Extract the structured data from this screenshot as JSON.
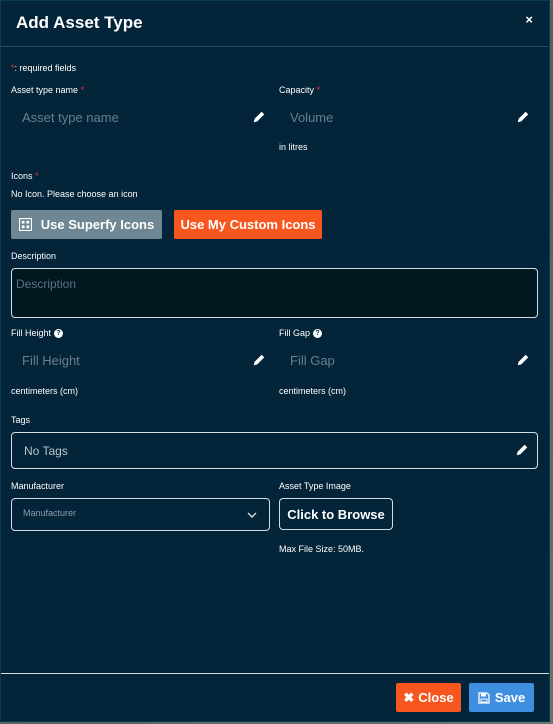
{
  "dialog": {
    "title": "Add Asset Type",
    "close_symbol": "×"
  },
  "required_note": {
    "star": "*",
    "text": ": required fields"
  },
  "asset_type_name": {
    "label": "Asset type name",
    "star": "*",
    "placeholder": "Asset type name"
  },
  "capacity": {
    "label": "Capacity",
    "star": "*",
    "placeholder": "Volume",
    "unit": "in litres"
  },
  "icons": {
    "label": "Icons",
    "star": "*",
    "status": "No Icon. Please choose an icon",
    "superfy_button": "Use Superfy Icons",
    "custom_button": "Use My Custom Icons"
  },
  "description": {
    "label": "Description",
    "placeholder": "Description"
  },
  "fill_height": {
    "label": "Fill Height",
    "help": "?",
    "placeholder": "Fill Height",
    "unit": "centimeters (cm)"
  },
  "fill_gap": {
    "label": "Fill Gap",
    "help": "?",
    "placeholder": "Fill Gap",
    "unit": "centimeters (cm)"
  },
  "tags": {
    "label": "Tags",
    "placeholder": "No Tags"
  },
  "manufacturer": {
    "label": "Manufacturer",
    "placeholder": "Manufacturer"
  },
  "asset_type_image": {
    "label": "Asset Type Image",
    "browse_button": "Click to Browse",
    "max_size": "Max File Size: 50MB."
  },
  "footer": {
    "close_button": "Close",
    "save_button": "Save"
  },
  "colors": {
    "modal_bg": "#032439",
    "accent_orange": "#f7561f",
    "accent_blue": "#3f8fe0",
    "required_red": "#e53935"
  },
  "icons_used": [
    "close-icon",
    "pencil-icon",
    "grid-icon",
    "chevron-down-icon",
    "help-icon",
    "times-icon",
    "save-icon"
  ]
}
